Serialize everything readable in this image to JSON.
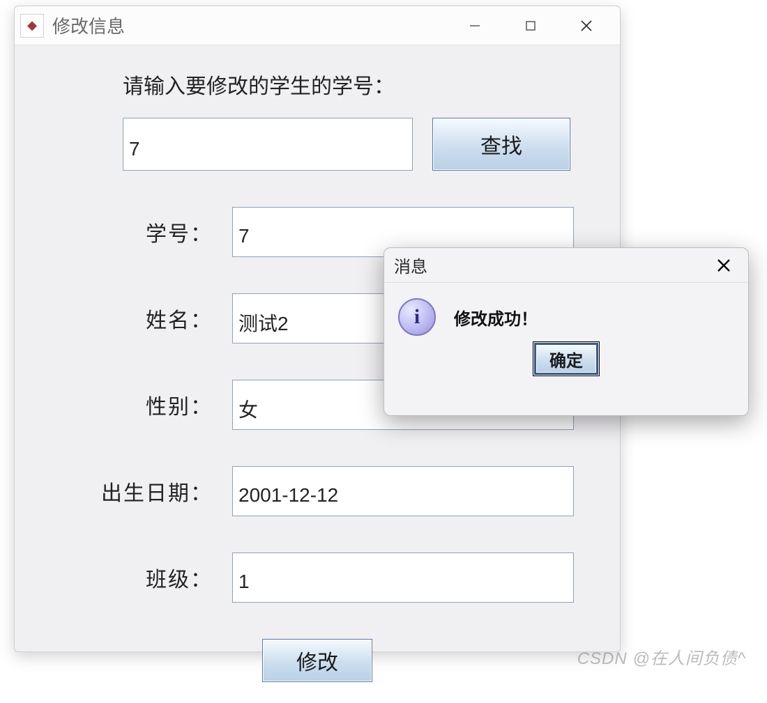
{
  "window": {
    "title": "修改信息"
  },
  "prompt": "请输入要修改的学生的学号：",
  "search": {
    "value": "7",
    "button_label": "查找"
  },
  "fields": {
    "student_id": {
      "label": "学号：",
      "value": "7"
    },
    "name": {
      "label": "姓名：",
      "value": "测试2"
    },
    "gender": {
      "label": "性别：",
      "value": "女"
    },
    "birthdate": {
      "label": "出生日期：",
      "value": "2001-12-12"
    },
    "class": {
      "label": "班级：",
      "value": "1"
    }
  },
  "submit_label": "修改",
  "dialog": {
    "title": "消息",
    "message": "修改成功！",
    "ok_label": "确定"
  },
  "watermark": "CSDN @在人间负债^"
}
